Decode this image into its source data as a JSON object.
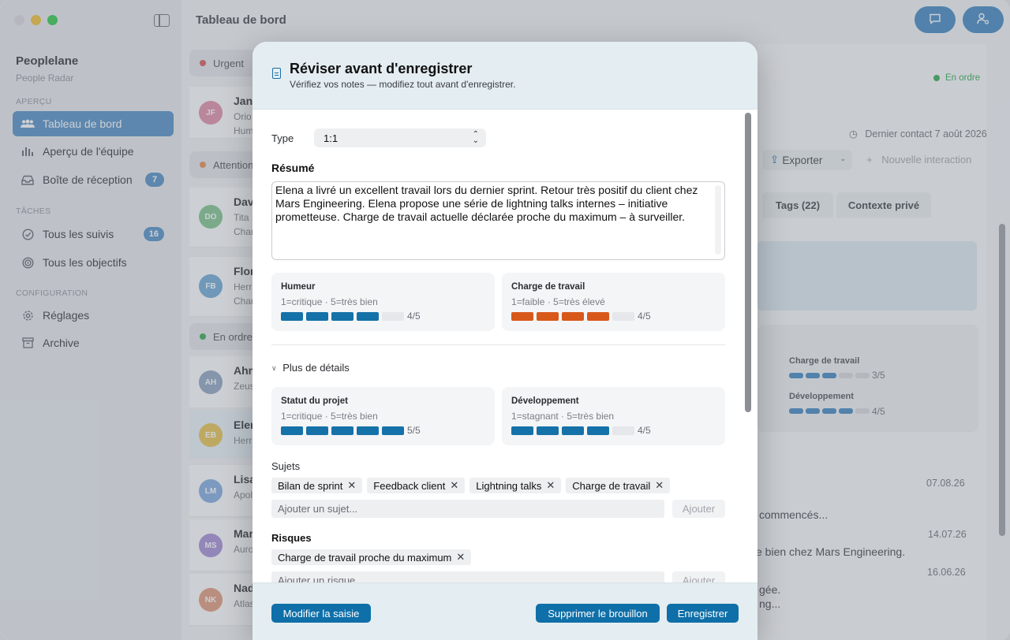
{
  "sidebar": {
    "app_name": "Peoplelane",
    "app_subtitle": "People Radar",
    "sections": {
      "overview": "APERÇU",
      "tasks": "TÂCHES",
      "config": "CONFIGURATION"
    },
    "items": [
      {
        "label": "Tableau de bord",
        "icon": "people-icon",
        "active": true
      },
      {
        "label": "Aperçu de l'équipe",
        "icon": "chart-icon"
      },
      {
        "label": "Boîte de réception",
        "icon": "inbox-icon",
        "count": "7"
      },
      {
        "label": "Tous les suivis",
        "icon": "check-circle-icon",
        "count": "16"
      },
      {
        "label": "Tous les objectifs",
        "icon": "target-icon"
      },
      {
        "label": "Réglages",
        "icon": "gear-icon"
      },
      {
        "label": "Archive",
        "icon": "archive-icon"
      }
    ]
  },
  "header": {
    "title": "Tableau de bord"
  },
  "list": {
    "groups": [
      {
        "label": "Urgent",
        "color": "#d9534f"
      },
      {
        "label": "Attention",
        "color": "#e8894a"
      },
      {
        "label": "En ordre",
        "color": "#2aa84a"
      }
    ],
    "rows": [
      {
        "initials": "JF",
        "name": "Jan",
        "sub1": "Orio",
        "sub2": "Hum",
        "color": "#e38aa4"
      },
      {
        "initials": "DO",
        "name": "Dav",
        "sub1": "Tita",
        "sub2": "Char",
        "color": "#7cc48b"
      },
      {
        "initials": "FB",
        "name": "Flor",
        "sub1": "Herr",
        "sub2": "Char",
        "color": "#6aa6d6"
      },
      {
        "initials": "AH",
        "name": "Ahm",
        "sub1": "Zeus",
        "color": "#8da2bf"
      },
      {
        "initials": "EB",
        "name": "Eler",
        "sub1": "Herr",
        "color": "#e9c24a"
      },
      {
        "initials": "LM",
        "name": "Lisa",
        "sub1": "Apol",
        "color": "#7fa8e0"
      },
      {
        "initials": "MS",
        "name": "Mar",
        "sub1": "Auro",
        "color": "#a389d6"
      },
      {
        "initials": "NK",
        "name": "Nad",
        "sub1": "Atlas",
        "color": "#e39777"
      }
    ]
  },
  "detail": {
    "status": "En ordre",
    "last_contact": "Dernier contact 7 août 2026",
    "export_label": "Exporter",
    "new_interaction": "Nouvelle interaction",
    "tabs": [
      "Tags (22)",
      "Contexte privé"
    ],
    "mini_metrics": [
      {
        "label": "Charge de travail",
        "value": "3/5",
        "level": 3
      },
      {
        "label": "Développement",
        "value": "4/5",
        "level": 4
      }
    ],
    "timeline": [
      {
        "date": "07.08.26",
        "text": "commencés..."
      },
      {
        "date": "14.07.26",
        "text": "e bien chez Mars Engineering."
      },
      {
        "date": "16.06.26",
        "text": "gée.",
        "text2": "ng..."
      }
    ]
  },
  "modal": {
    "title": "Réviser avant d'enregistrer",
    "subtitle": "Vérifiez vos notes — modifiez tout avant d'enregistrer.",
    "type_label": "Type",
    "type_value": "1:1",
    "summary_label": "Résumé",
    "summary_text": "Elena a livré un excellent travail lors du dernier sprint. Retour très positif du client chez Mars Engineering. Elena propose une série de lightning talks internes – initiative prometteuse. Charge de travail actuelle déclarée proche du maximum – à surveiller.",
    "metrics": [
      {
        "title": "Humeur",
        "scale": "1=critique · 5=très bien",
        "value": "4/5",
        "level": 4,
        "color": "blue"
      },
      {
        "title": "Charge de travail",
        "scale": "1=faible · 5=très élevé",
        "value": "4/5",
        "level": 4,
        "color": "orange"
      },
      {
        "title": "Statut du projet",
        "scale": "1=critique · 5=très bien",
        "value": "5/5",
        "level": 5,
        "color": "blue"
      },
      {
        "title": "Développement",
        "scale": "1=stagnant · 5=très bien",
        "value": "4/5",
        "level": 4,
        "color": "blue"
      }
    ],
    "more_details": "Plus de détails",
    "topics_label": "Sujets",
    "topics": [
      "Bilan de sprint",
      "Feedback client",
      "Lightning talks",
      "Charge de travail"
    ],
    "topic_placeholder": "Ajouter un sujet...",
    "risks_label": "Risques",
    "risks": [
      "Charge de travail proche du maximum"
    ],
    "risk_placeholder": "Ajouter un risque...",
    "add_label": "Ajouter",
    "buttons": {
      "edit": "Modifier la saisie",
      "delete": "Supprimer le brouillon",
      "save": "Enregistrer"
    }
  }
}
